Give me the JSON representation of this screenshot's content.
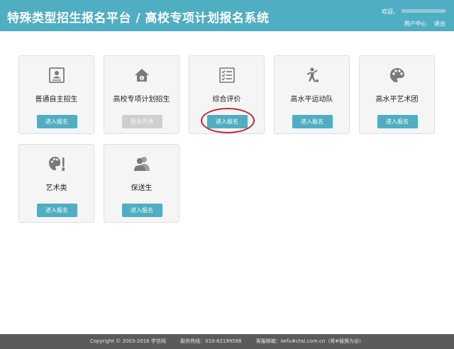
{
  "header": {
    "title": "特殊类型招生报名平台 / 高校专项计划报名系统",
    "welcome": "欢迎，",
    "user_center": "用户中心",
    "logout": "退出"
  },
  "cards": [
    {
      "label": "普通自主招生",
      "button": "进入报名",
      "icon": "id-card-icon",
      "enabled": true
    },
    {
      "label": "高校专项计划招生",
      "button": "暂未开通",
      "icon": "house-dollar-icon",
      "enabled": false
    },
    {
      "label": "综合评价",
      "button": "进入报名",
      "icon": "checklist-icon",
      "enabled": true,
      "highlighted": true
    },
    {
      "label": "高水平运动队",
      "button": "进入报名",
      "icon": "athlete-icon",
      "enabled": true
    },
    {
      "label": "高水平艺术团",
      "button": "进入报名",
      "icon": "palette-icon",
      "enabled": true
    },
    {
      "label": "艺术类",
      "button": "进入报名",
      "icon": "paint-brush-icon",
      "enabled": true
    },
    {
      "label": "保送生",
      "button": "进入报名",
      "icon": "users-icon",
      "enabled": true
    }
  ],
  "footer": {
    "copyright": "Copyright © 2003-2016 学信网",
    "hotline": "服务热线：010-82199588",
    "email": "客服邮箱：kefu#chsi.com.cn（将#替换为@）"
  },
  "colors": {
    "primary": "#4faec2",
    "disabled": "#cfcfcf",
    "footer": "#5b5b5b",
    "highlight": "#c8262e"
  }
}
